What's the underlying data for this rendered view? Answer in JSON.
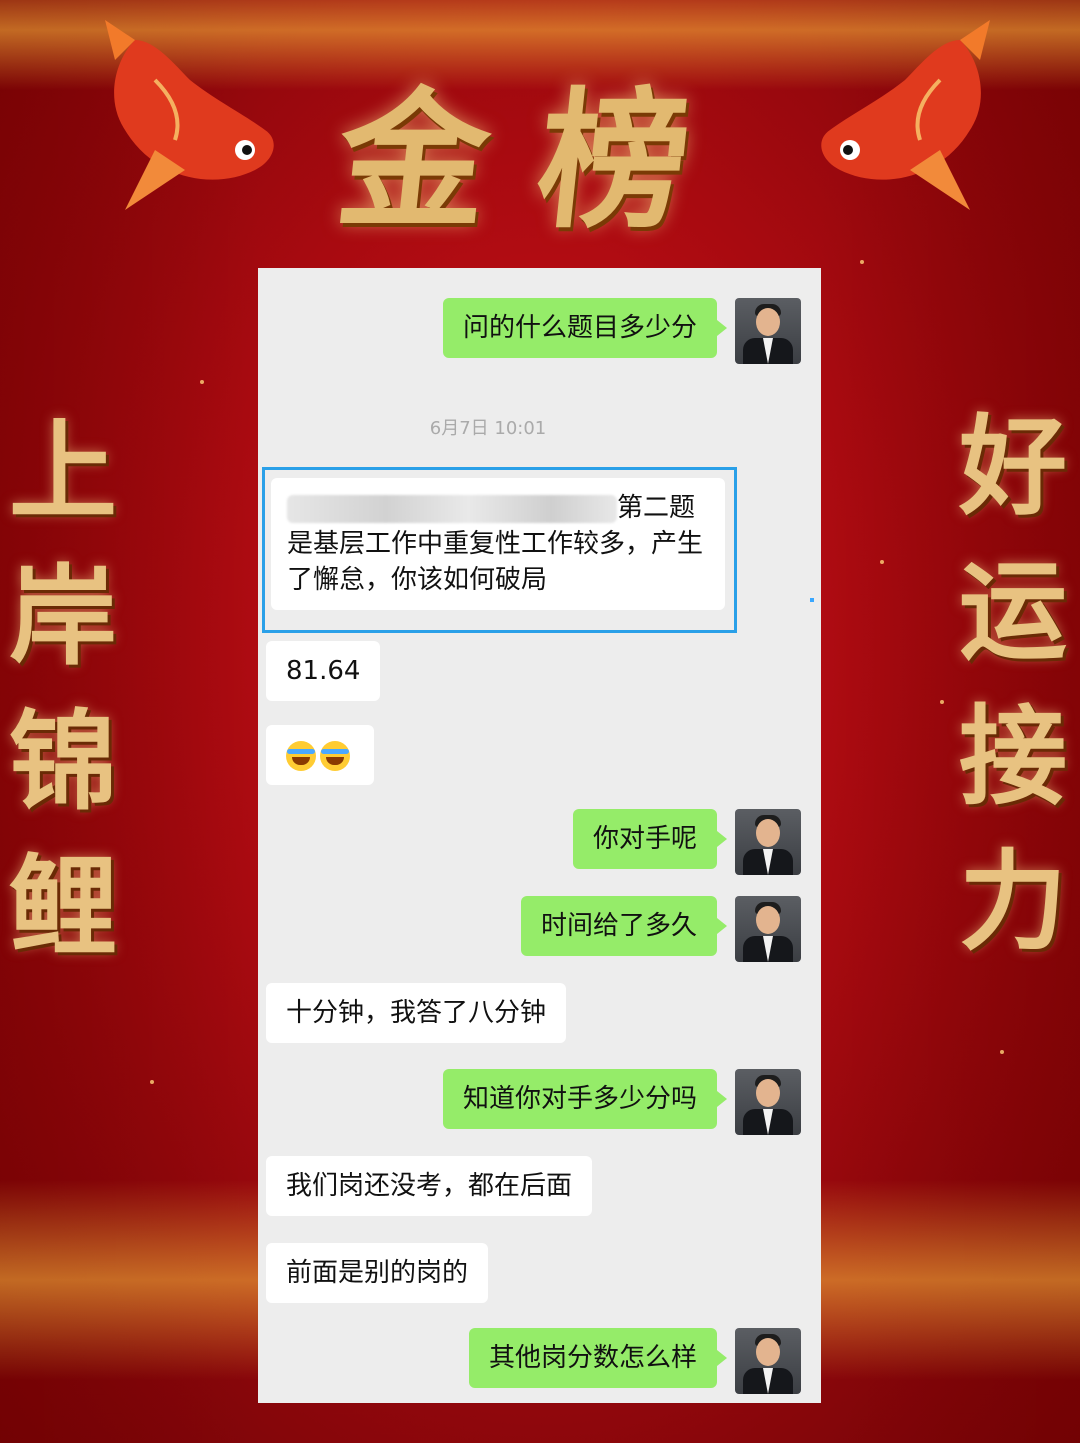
{
  "banner": {
    "title": "金榜",
    "left_text": "上岸锦鲤",
    "right_text": "好运接力"
  },
  "chat": {
    "timestamp": "6月7日 10:01",
    "messages": [
      {
        "from": "me",
        "text": "问的什么题目多少分"
      },
      {
        "from": "other",
        "text": "第二题是基层工作中重复性工作较多，产生了懈怠，你该如何破局"
      },
      {
        "from": "other",
        "text": "81.64"
      },
      {
        "from": "other",
        "text": "😂😂"
      },
      {
        "from": "me",
        "text": "你对手呢"
      },
      {
        "from": "me",
        "text": "时间给了多久"
      },
      {
        "from": "other",
        "text": "十分钟，我答了八分钟"
      },
      {
        "from": "me",
        "text": "知道你对手多少分吗"
      },
      {
        "from": "other",
        "text": "我们岗还没考，都在后面"
      },
      {
        "from": "other",
        "text": "前面是别的岗的"
      },
      {
        "from": "me",
        "text": "其他岗分数怎么样"
      }
    ]
  },
  "colors": {
    "background_red": "#c8101a",
    "gold_text": "#e2b970",
    "my_bubble": "#95ec69",
    "highlight_border": "#2aa0e8"
  }
}
